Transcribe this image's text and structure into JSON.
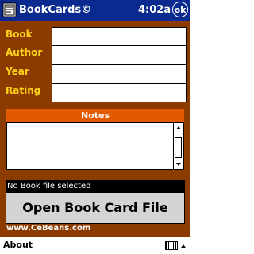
{
  "titlebar": {
    "app_title": "BookCards©",
    "time": "4:02a",
    "ok_label": "ok"
  },
  "form": {
    "book_label": "Book",
    "author_label": "Author",
    "year_label": "Year",
    "rating_label": "Rating",
    "book_value": "",
    "author_value": "",
    "year_value": "",
    "rating_value": ""
  },
  "notes": {
    "header": "Notes",
    "value": ""
  },
  "status_text": "No Book file selected",
  "open_button_label": "Open Book Card File",
  "website": "www.CeBeans.com",
  "menubar": {
    "about_label": "About"
  },
  "icons": {
    "app": "book-icon",
    "keyboard": "keyboard-icon"
  },
  "colors": {
    "titlebar": "#0a2a8f",
    "panel": "#8b3b00",
    "label": "#ffd21a",
    "notes_header": "#e25a00"
  }
}
